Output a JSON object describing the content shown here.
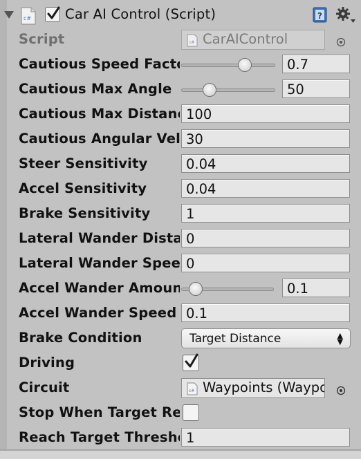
{
  "component": {
    "title": "Car AI Control (Script)",
    "enabled": true
  },
  "script_field": {
    "label": "Script",
    "value": "CarAIControl"
  },
  "fields": {
    "cautious_speed_factor": {
      "label": "Cautious Speed Factor",
      "value": "0.7",
      "slider_fraction": 0.7
    },
    "cautious_max_angle": {
      "label": "Cautious Max Angle",
      "value": "50",
      "slider_fraction": 0.28
    },
    "cautious_max_distance": {
      "label": "Cautious Max Distance",
      "value": "100"
    },
    "cautious_angular_velocity": {
      "label": "Cautious Angular Velocity",
      "value": "30"
    },
    "steer_sensitivity": {
      "label": "Steer Sensitivity",
      "value": "0.04"
    },
    "accel_sensitivity": {
      "label": "Accel Sensitivity",
      "value": "0.04"
    },
    "brake_sensitivity": {
      "label": "Brake Sensitivity",
      "value": "1"
    },
    "lateral_wander_distance": {
      "label": "Lateral Wander Distance",
      "value": "0"
    },
    "lateral_wander_speed": {
      "label": "Lateral Wander Speed",
      "value": "0"
    },
    "accel_wander_amount": {
      "label": "Accel Wander Amount",
      "value": "0.1",
      "slider_fraction": 0.1
    },
    "accel_wander_speed": {
      "label": "Accel Wander Speed",
      "value": "0.1"
    },
    "brake_condition": {
      "label": "Brake Condition",
      "value": "Target Distance"
    },
    "driving": {
      "label": "Driving",
      "checked": true
    },
    "circuit": {
      "label": "Circuit",
      "value": "Waypoints (WaypointCircuit)"
    },
    "stop_when_target_reached": {
      "label": "Stop When Target Reached",
      "checked": false
    },
    "reach_target_threshold": {
      "label": "Reach Target Threshold",
      "value": "1"
    }
  },
  "icons": {
    "foldout": "triangle-down-icon",
    "script": "csharp-script-icon",
    "help": "help-book-icon",
    "settings": "gear-icon",
    "picker": "object-picker-icon"
  },
  "colors": {
    "panel_bg": "#c2c2c2",
    "field_bg": "#e6e6e6",
    "help_blue": "#3f6fb8"
  }
}
